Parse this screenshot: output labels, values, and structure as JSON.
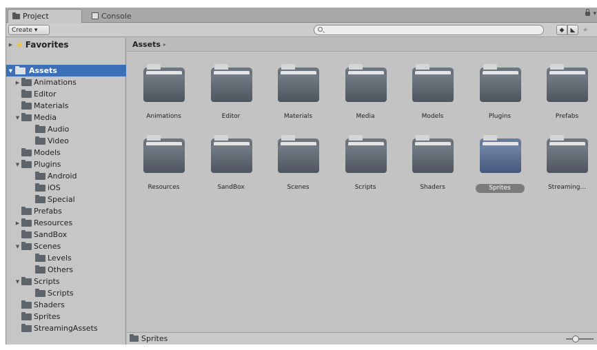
{
  "tabs": {
    "project": "Project",
    "console": "Console"
  },
  "toolbar": {
    "create_label": "Create",
    "create_caret": "▾",
    "search_placeholder": "",
    "filter_type_icon": "search-by-type-icon",
    "filter_label_icon": "search-by-label-icon",
    "favorite_icon": "star-icon"
  },
  "sidebar": {
    "favorites_label": "Favorites",
    "assets_label": "Assets",
    "tree": [
      {
        "label": "Animations",
        "arrow": "▶"
      },
      {
        "label": "Editor",
        "arrow": ""
      },
      {
        "label": "Materials",
        "arrow": ""
      },
      {
        "label": "Media",
        "arrow": "▼"
      },
      {
        "label": "Audio",
        "arrow": ""
      },
      {
        "label": "Video",
        "arrow": ""
      },
      {
        "label": "Models",
        "arrow": ""
      },
      {
        "label": "Plugins",
        "arrow": "▼"
      },
      {
        "label": "Android",
        "arrow": ""
      },
      {
        "label": "iOS",
        "arrow": ""
      },
      {
        "label": "Special",
        "arrow": ""
      },
      {
        "label": "Prefabs",
        "arrow": ""
      },
      {
        "label": "Resources",
        "arrow": "▶"
      },
      {
        "label": "SandBox",
        "arrow": ""
      },
      {
        "label": "Scenes",
        "arrow": "▼"
      },
      {
        "label": "Levels",
        "arrow": ""
      },
      {
        "label": "Others",
        "arrow": ""
      },
      {
        "label": "Scripts",
        "arrow": "▼"
      },
      {
        "label": "Scripts",
        "arrow": ""
      },
      {
        "label": "Shaders",
        "arrow": ""
      },
      {
        "label": "Sprites",
        "arrow": ""
      },
      {
        "label": "StreamingAssets",
        "arrow": ""
      }
    ]
  },
  "assets": {
    "header": "Assets",
    "header_caret": "▸",
    "folders": [
      "Animations",
      "Editor",
      "Materials",
      "Media",
      "Models",
      "Plugins",
      "Prefabs",
      "Resources",
      "SandBox",
      "Scenes",
      "Scripts",
      "Shaders",
      "Sprites",
      "Streaming..."
    ],
    "selected": "Sprites"
  },
  "status": {
    "selected_path": "Sprites",
    "zoom": 0.3
  },
  "colors": {
    "selection": "#3b70b9",
    "panel": "#c2c2c2",
    "folder": "#5d646c"
  }
}
